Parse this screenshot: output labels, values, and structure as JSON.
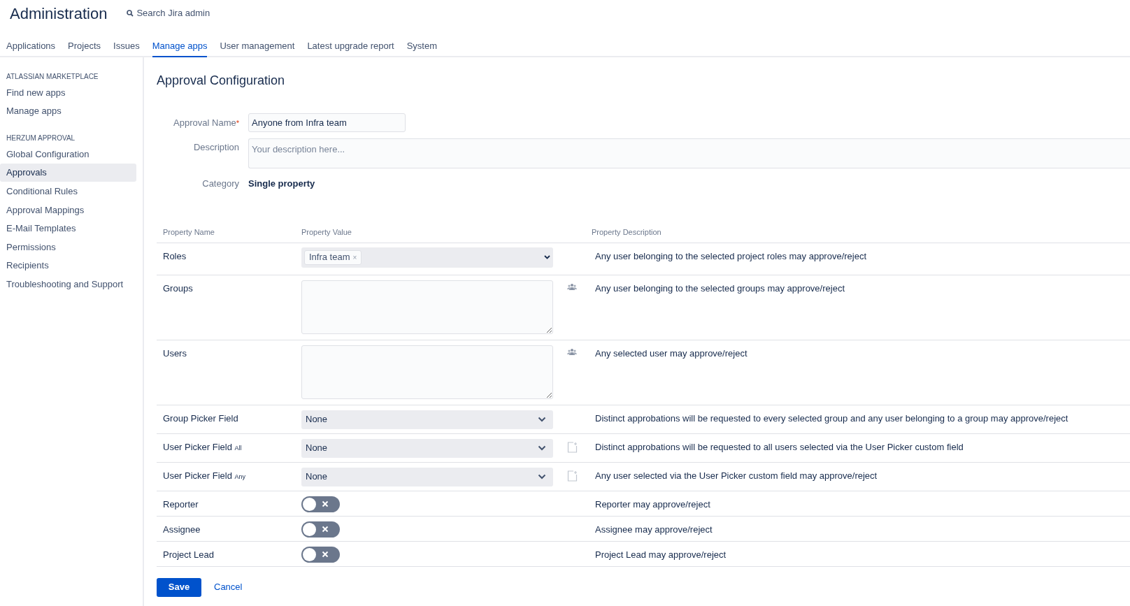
{
  "header": {
    "title": "Administration",
    "search": "Search Jira admin"
  },
  "tabs": [
    {
      "label": "Applications",
      "selected": false
    },
    {
      "label": "Projects",
      "selected": false
    },
    {
      "label": "Issues",
      "selected": false
    },
    {
      "label": "Manage apps",
      "selected": true
    },
    {
      "label": "User management",
      "selected": false
    },
    {
      "label": "Latest upgrade report",
      "selected": false
    },
    {
      "label": "System",
      "selected": false
    }
  ],
  "sidebar": {
    "sections": [
      {
        "heading": "ATLASSIAN MARKETPLACE",
        "items": [
          {
            "label": "Find new apps",
            "selected": false
          },
          {
            "label": "Manage apps",
            "selected": false
          }
        ]
      },
      {
        "heading": "HERZUM APPROVAL",
        "items": [
          {
            "label": "Global Configuration",
            "selected": false
          },
          {
            "label": "Approvals",
            "selected": true
          },
          {
            "label": "Conditional Rules",
            "selected": false
          },
          {
            "label": "Approval Mappings",
            "selected": false
          },
          {
            "label": "E-Mail Templates",
            "selected": false
          },
          {
            "label": "Permissions",
            "selected": false
          },
          {
            "label": "Recipients",
            "selected": false
          },
          {
            "label": "Troubleshooting and Support",
            "selected": false
          }
        ]
      }
    ]
  },
  "page_title": "Approval Configuration",
  "form": {
    "name_label": "Approval Name",
    "required_mark": "*",
    "name_value": "Anyone from Infra team",
    "description_label": "Description",
    "description_placeholder": "Your description here...",
    "category_label": "Category",
    "category_value": "Single property"
  },
  "table": {
    "columns": [
      "Property Name",
      "Property Value",
      "Property Description"
    ],
    "rows": [
      {
        "kind": "multiselect",
        "name": "Roles",
        "tags": [
          "Infra team"
        ],
        "remove": "×",
        "description": "Any user belonging to the selected project roles may approve/reject"
      },
      {
        "kind": "textarea",
        "name": "Groups",
        "description": "Any user belonging to the selected groups may approve/reject"
      },
      {
        "kind": "textarea",
        "name": "Users",
        "description": "Any selected user may approve/reject"
      },
      {
        "kind": "select",
        "name": "Group Picker Field",
        "value": "None",
        "description": "Distinct approbations will be requested to every selected group and any user belonging to a group may approve/reject"
      },
      {
        "kind": "select",
        "name": "User Picker Field",
        "note": "All",
        "value": "None",
        "description": "Distinct approbations will be requested to all users selected via the User Picker custom field"
      },
      {
        "kind": "select",
        "name": "User Picker Field",
        "note": "Any",
        "value": "None",
        "description": "Any user selected via the User Picker custom field may approve/reject"
      },
      {
        "kind": "toggle",
        "name": "Reporter",
        "on": false,
        "description": "Reporter may approve/reject"
      },
      {
        "kind": "toggle",
        "name": "Assignee",
        "on": false,
        "description": "Assignee may approve/reject"
      },
      {
        "kind": "toggle",
        "name": "Project Lead",
        "on": false,
        "description": "Project Lead may approve/reject"
      }
    ]
  },
  "buttons": {
    "save": "Save",
    "cancel": "Cancel"
  }
}
